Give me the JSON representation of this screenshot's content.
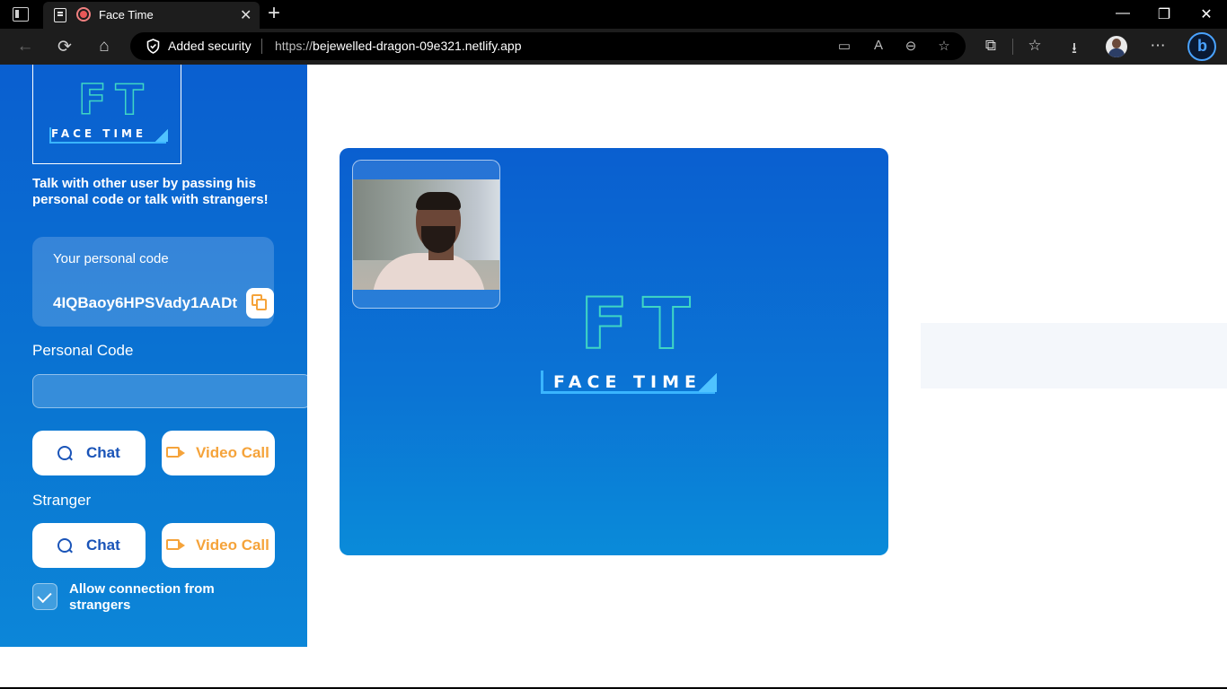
{
  "browser": {
    "tab_title": "Face Time",
    "tab_close": "✕",
    "new_tab": "+",
    "window_minimize": "—",
    "window_restore": "❐",
    "window_close": "✕",
    "security_label": "Added security",
    "url_protocol": "https://",
    "url_host": "bejewelled-dragon-09e321.netlify.app",
    "icons": {
      "back": "←",
      "refresh": "⟳",
      "home": "⌂",
      "camera": "▭",
      "read_aloud": "A",
      "zoom": "⊖",
      "favorite": "☆",
      "extensions": "⧉",
      "favorites": "☆",
      "downloads": "⭳",
      "more": "⋯",
      "bing": "b"
    }
  },
  "sidebar": {
    "logo": {
      "letters": "FT",
      "word": "FACE TIME"
    },
    "intro": "Talk with other user by passing his personal code or talk with strangers!",
    "personal_code_card": {
      "label": "Your personal code",
      "value": "4IQBaoy6HPSVady1AADt"
    },
    "personal_code_section": {
      "title": "Personal Code",
      "input_value": "",
      "chat_label": "Chat",
      "video_label": "Video Call"
    },
    "stranger_section": {
      "title": "Stranger",
      "chat_label": "Chat",
      "video_label": "Video Call"
    },
    "allow_strangers": {
      "label": "Allow connection from strangers",
      "checked": true
    }
  },
  "video_area": {
    "logo": {
      "letters": "FT",
      "word": "FACE TIME"
    }
  },
  "colors": {
    "primary_blue": "#0a5fd0",
    "accent_orange": "#f5a33a",
    "logo_teal": "#3fd6c4"
  }
}
